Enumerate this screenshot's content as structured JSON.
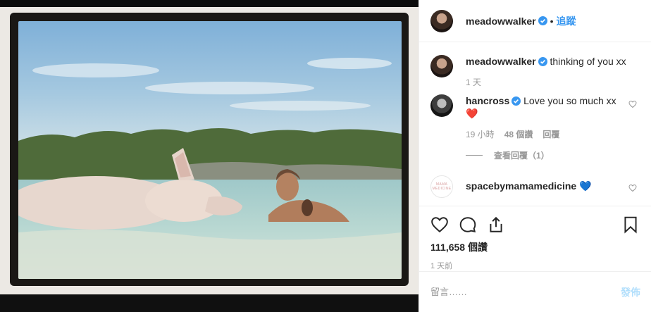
{
  "post": {
    "author": "meadowwalker",
    "follow_separator": "•",
    "follow_label": "追蹤"
  },
  "caption": {
    "username": "meadowwalker",
    "text": "thinking of you xx",
    "time": "1 天"
  },
  "comments": [
    {
      "username": "hancross",
      "text": "Love you so much xx",
      "emoji": "❤️",
      "time": "19 小時",
      "likes": "48 個讚",
      "reply_label": "回覆",
      "view_replies": "查看回覆（1）"
    },
    {
      "username": "spacebymamamedicine",
      "emoji": "💙",
      "avatar_text": "MAMA MEDICINE"
    }
  ],
  "stats": {
    "likes": "111,658 個讚",
    "posted": "1 天前"
  },
  "comment_box": {
    "placeholder": "留言……",
    "post_label": "發佈"
  },
  "colors": {
    "accent": "#3897f0",
    "verified": "#3897f0",
    "post_disabled": "#b2dffc",
    "heart_red": "#ed4956",
    "heart_blue": "#2aa9e0"
  },
  "icons": [
    "verified-badge-icon",
    "heart-icon",
    "comment-icon",
    "share-icon",
    "bookmark-icon"
  ]
}
